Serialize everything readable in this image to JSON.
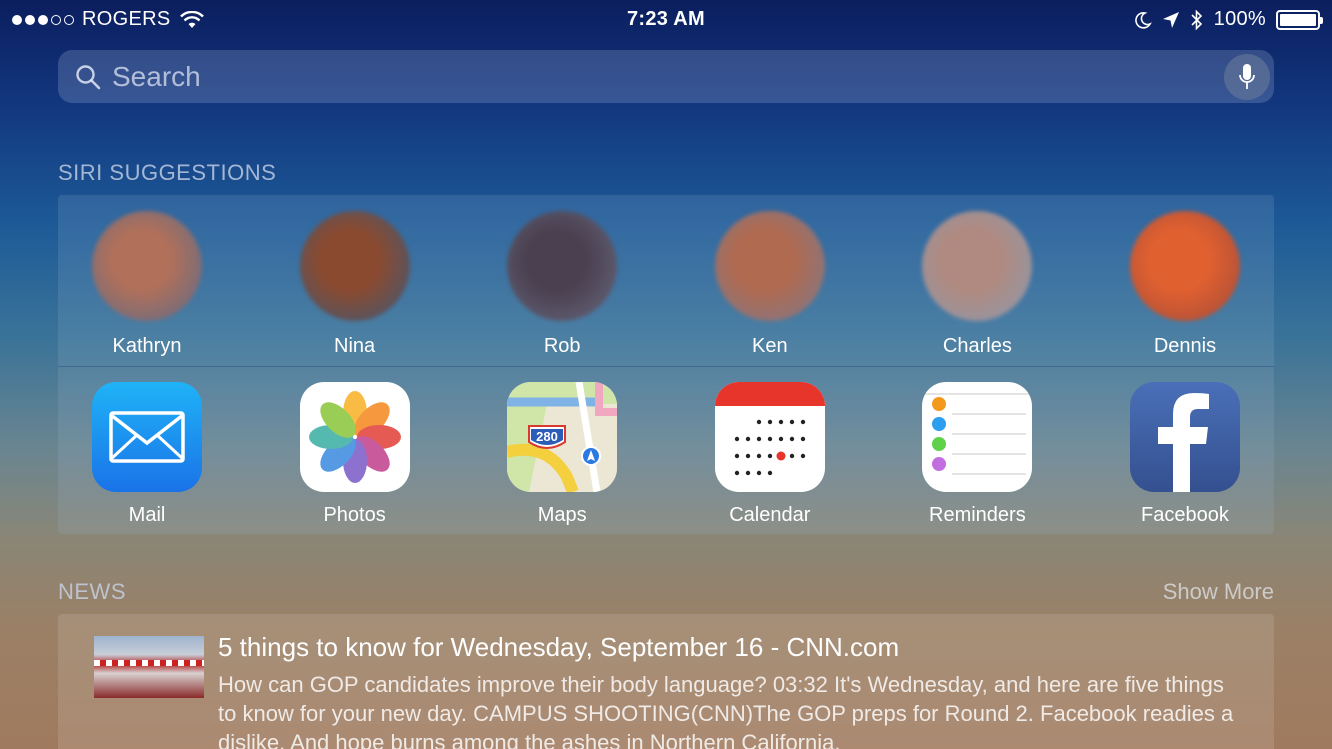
{
  "status_bar": {
    "carrier": "ROGERS",
    "time": "7:23 AM",
    "battery": "100%",
    "battery_level": 1.0
  },
  "search": {
    "placeholder": "Search"
  },
  "siri": {
    "title": "SIRI SUGGESTIONS",
    "contacts": [
      {
        "name": "Kathryn",
        "color_a": "#b0705a",
        "color_b": "#5a6a8a"
      },
      {
        "name": "Nina",
        "color_a": "#8a4a30",
        "color_b": "#3a5a7a"
      },
      {
        "name": "Rob",
        "color_a": "#4a4050",
        "color_b": "#6a6a80"
      },
      {
        "name": "Ken",
        "color_a": "#b06a50",
        "color_b": "#7a7a90"
      },
      {
        "name": "Charles",
        "color_a": "#b08a80",
        "color_b": "#8a9ab0"
      },
      {
        "name": "Dennis",
        "color_a": "#e06030",
        "color_b": "#a04a3a"
      }
    ],
    "apps": [
      {
        "name": "Mail",
        "icon": "mail-icon"
      },
      {
        "name": "Photos",
        "icon": "photos-icon"
      },
      {
        "name": "Maps",
        "icon": "maps-icon",
        "badge": "280"
      },
      {
        "name": "Calendar",
        "icon": "calendar-icon"
      },
      {
        "name": "Reminders",
        "icon": "reminders-icon"
      },
      {
        "name": "Facebook",
        "icon": "facebook-icon"
      }
    ]
  },
  "news": {
    "title": "NEWS",
    "show_more": "Show More",
    "item": {
      "title": "5 things to know for Wednesday, September 16 - CNN.com",
      "body": "How can GOP candidates improve their body language? 03:32  It's Wednesday, and here are five things to know for your new day.   CAMPUS SHOOTING(CNN)The GOP preps for Round 2. Facebook readies a dislike. And hope burns among the ashes in Northern California."
    }
  }
}
